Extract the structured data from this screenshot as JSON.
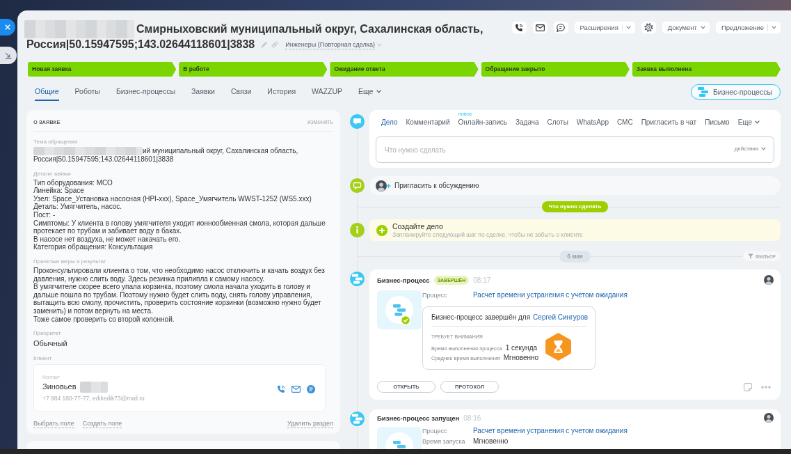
{
  "title": {
    "line_1": "Смирныховский муниципальный округ, Сахалинская область,",
    "line_2": "Россия|50.15947595;143.02644118601|3838"
  },
  "pipeline": "Инженеры (Повторная сделка)",
  "header_buttons": [
    {
      "label": "Расширения",
      "kind": "split"
    },
    {
      "label": "Документ",
      "kind": "dropdown"
    },
    {
      "label": "Предложение",
      "kind": "split"
    }
  ],
  "stages": [
    {
      "label": "Новая заявка",
      "reached": true
    },
    {
      "label": "В работе",
      "reached": true
    },
    {
      "label": "Ожидание ответа",
      "reached": true
    },
    {
      "label": "Обращение закрыто",
      "reached": true
    },
    {
      "label": "Заявка выполнена",
      "reached": true
    }
  ],
  "tabs": [
    {
      "label": "Общие",
      "kind": "tab",
      "selected": true
    },
    {
      "label": "Роботы",
      "kind": "tab",
      "selected": false
    },
    {
      "label": "Бизнес-процессы",
      "kind": "tab",
      "selected": false
    },
    {
      "label": "Заявки",
      "kind": "tab",
      "selected": false
    },
    {
      "label": "Связи",
      "kind": "tab",
      "selected": false
    },
    {
      "label": "История",
      "kind": "tab",
      "selected": false
    },
    {
      "label": "WAZZUP",
      "kind": "tab",
      "selected": false
    },
    {
      "label": "Еще",
      "kind": "menu",
      "selected": false
    }
  ],
  "bp_button": "Бизнес-процессы",
  "details": {
    "title": "О ЗАЯВКЕ",
    "edit": "изменить",
    "fields": [
      {
        "label": "Тема обращения",
        "kind": "masked",
        "lines": [
          "ий муниципальный округ, Сахалинская область,",
          "Россия|50.15947595;143.02644118601|3838"
        ]
      },
      {
        "label": "Детали заявки",
        "kind": "text",
        "lines": [
          "Тип оборудования: МСО",
          "Линейка: Space",
          "Узел: Space_Установка насосная (HPI-xxx), Space_Умягчитель WWST-1252 (WS5.xxx)",
          "Деталь: Умягчитель, насос.",
          "Пост: -",
          "Симптомы: У клиента в голову умягчителя уходит ионнообменная смола, которая дальше протекает по трубам и забивает воду в баках.",
          "В насосе нет воздуха, не может накачать его.",
          "Категория обращения: Консультация"
        ]
      },
      {
        "label": "Принятые меры и результат",
        "kind": "text",
        "lines": [
          "Проконсультировали клиента о том, что необходимо насос отключить и качать воздух без давления, нужно слить воду. Здесь резинка прилипла к самому насосу.",
          "В умягчителе скорее всего упала корзинка, поэтому смола начала уходить в голову и дальше пошла по трубам. Поэтому нужно будет слить воду, снять голову управления, вытащить всю смолу, прочистить, проверить состояние корзинки (возможно нужно будет заменить) и потом вернуть на места.",
          "Тоже самое проверить со второй колонной."
        ]
      },
      {
        "label": "Приоритет",
        "kind": "value",
        "lines": [
          "Обычный"
        ]
      },
      {
        "label": "Клиент",
        "kind": "client",
        "contact_label": "Контакт",
        "name": "Зиновьев",
        "details": "+7 984 180-77-77, edikedik73@mail.ru"
      }
    ],
    "links": [
      "Выбрать поле",
      "Создать поле"
    ],
    "delete": "Удалить раздел"
  },
  "composer": {
    "tabs": [
      {
        "label": "Дело",
        "kind": "tab",
        "selected": true
      },
      {
        "label": "Комментарий",
        "kind": "tab",
        "selected": false
      },
      {
        "label": "Онлайн-запись",
        "kind": "tab",
        "selected": false,
        "badge": "новое"
      },
      {
        "label": "Задача",
        "kind": "tab",
        "selected": false
      },
      {
        "label": "Слоты",
        "kind": "tab",
        "selected": false
      },
      {
        "label": "WhatsApp",
        "kind": "tab",
        "selected": false
      },
      {
        "label": "СМС",
        "kind": "tab",
        "selected": false
      },
      {
        "label": "Пригласить в чат",
        "kind": "tab",
        "selected": false
      },
      {
        "label": "Письмо",
        "kind": "tab",
        "selected": false
      },
      {
        "label": "Еще",
        "kind": "menu",
        "selected": false
      }
    ],
    "placeholder": "Что нужно сделать",
    "actions": "действия"
  },
  "invite": "Пригласить к обсуждению",
  "todo_divider": "Что нужно сделать",
  "create_task": {
    "title": "Создайте дело",
    "hint": "Запланируйте следующий шаг по сделке, чтобы не забыть о клиенте"
  },
  "date_divider": "6 мая",
  "filter": "ФИЛЬТР",
  "events": [
    {
      "title": "Бизнес-процесс",
      "status": "ЗАВЕРШЁН",
      "time": "08:17",
      "fields": [
        {
          "label": "Процесс",
          "kind": "link",
          "value": "Расчет времени устранения с учетом ожидания"
        }
      ],
      "result": {
        "text": "Бизнес-процесс завершён для",
        "user": "Сергей Сингуров",
        "heading": "ТРЕБУЕТ ВНИМАНИЯ",
        "metrics": [
          {
            "label": "Время выполнения процесса",
            "value": "1 секунда"
          },
          {
            "label": "Среднее время выполнения",
            "value": "Мгновенно"
          }
        ]
      },
      "buttons": [
        "ОТКРЫТЬ",
        "ПРОТОКОЛ"
      ]
    },
    {
      "title": "Бизнес-процесс запущен",
      "time": "08:16",
      "fields": [
        {
          "label": "Процесс",
          "kind": "link",
          "value": "Расчет времени устранения с учетом ожидания"
        },
        {
          "label": "Время запуска",
          "kind": "text",
          "value": "Мгновенно"
        }
      ]
    }
  ]
}
